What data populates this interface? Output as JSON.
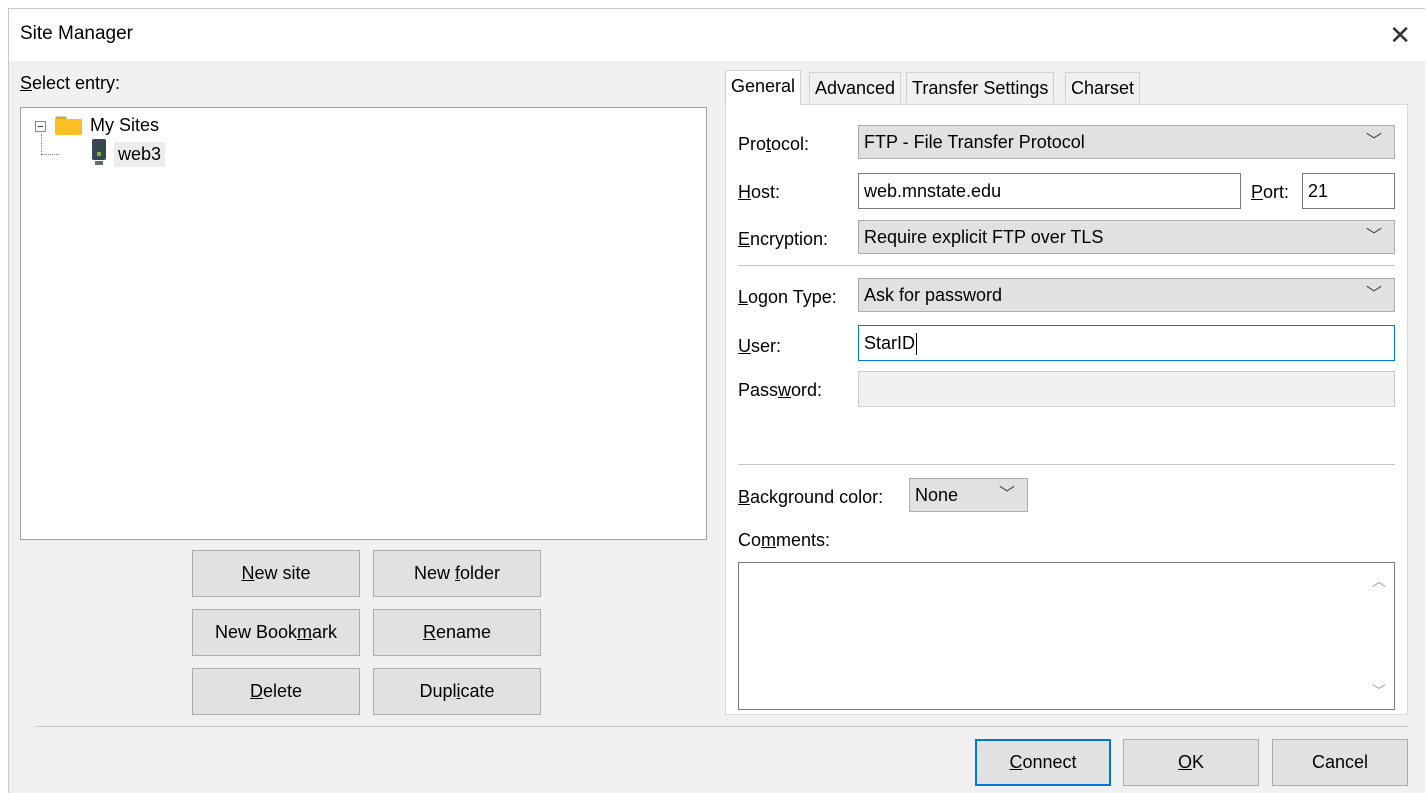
{
  "window": {
    "title": "Site Manager",
    "close_glyph": "✕"
  },
  "select_entry": {
    "pre": "",
    "ul": "S",
    "post": "elect entry:"
  },
  "tree": {
    "root": {
      "label": "My Sites",
      "icon": "folder-icon",
      "expander_icon": "minus-box-icon"
    },
    "site": {
      "label": "web3",
      "icon": "server-icon"
    }
  },
  "left_buttons": {
    "new_site": {
      "pre": "",
      "ul": "N",
      "post": "ew site"
    },
    "new_folder": {
      "pre": "New ",
      "ul": "f",
      "post": "older"
    },
    "new_bookmark": {
      "pre": "New Book",
      "ul": "m",
      "post": "ark"
    },
    "rename": {
      "pre": "",
      "ul": "R",
      "post": "ename"
    },
    "delete": {
      "pre": "",
      "ul": "D",
      "post": "elete"
    },
    "duplicate": {
      "pre": "Dupl",
      "ul": "i",
      "post": "cate"
    }
  },
  "tabs": [
    {
      "label": "General",
      "active": true
    },
    {
      "label": "Advanced",
      "active": false
    },
    {
      "label": "Transfer Settings",
      "active": false
    },
    {
      "label": "Charset",
      "active": false
    }
  ],
  "general": {
    "protocol": {
      "pre": "Pro",
      "ul": "t",
      "post": "ocol:",
      "value": "FTP - File Transfer Protocol"
    },
    "host": {
      "pre": "",
      "ul": "H",
      "post": "ost:",
      "value": "web.mnstate.edu"
    },
    "port": {
      "pre": "",
      "ul": "P",
      "post": "ort:",
      "value": "21"
    },
    "encryption": {
      "pre": "",
      "ul": "E",
      "post": "ncryption:",
      "value": "Require explicit FTP over TLS"
    },
    "logon_type": {
      "pre": "",
      "ul": "L",
      "post": "ogon Type:",
      "value": "Ask for password"
    },
    "user": {
      "pre": "",
      "ul": "U",
      "post": "ser:",
      "value": "StarID"
    },
    "password": {
      "pre": "Pass",
      "ul": "w",
      "post": "ord:",
      "value": ""
    },
    "background_color": {
      "pre": "",
      "ul": "B",
      "post": "ackground color:",
      "value": "None"
    },
    "comments": {
      "pre": "Co",
      "ul": "m",
      "post": "ments:",
      "value": ""
    }
  },
  "bottom_buttons": {
    "connect": {
      "pre": "",
      "ul": "C",
      "post": "onnect"
    },
    "ok": {
      "pre": "",
      "ul": "O",
      "post": "K"
    },
    "cancel": {
      "label": "Cancel"
    }
  },
  "icons": {
    "chevron": "﹀",
    "scroll_up": "︿",
    "scroll_down": "﹀"
  },
  "colors": {
    "focus_border": "#0078d7",
    "folder": "#fbbf24",
    "server": "#37474f"
  }
}
